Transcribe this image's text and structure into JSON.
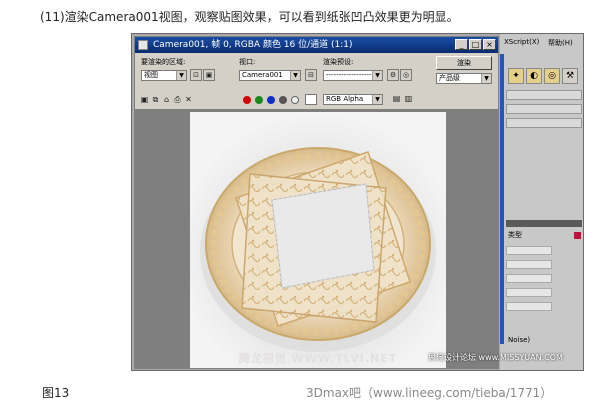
{
  "article": {
    "caption": "(11)渲染Camera001视图，观察贴图效果，可以看到纸张凹凸效果更为明显。",
    "figure_label": "图13",
    "bottom_watermark": "3Dmax吧（www.lineeg.com/tieba/1771）"
  },
  "render_window": {
    "title": "Camera001, 帧 0, RGBA 颜色 16 位/通道 (1:1)",
    "controls": {
      "min": "_",
      "restore": "□",
      "close": "×"
    },
    "area_label": "要渲染的区域:",
    "area_value": "视图",
    "viewport_label": "视口:",
    "viewport_value": "Camera001",
    "preset_label": "渲染预设:",
    "preset_value": "--------------------",
    "render_button": "渲染",
    "product_value": "产品级",
    "channel_value": "RGB Alpha",
    "swatch_colors": [
      "#d40000",
      "#1a8a1a",
      "#1030c0"
    ],
    "canvas_watermark": "腾龙视觉 WWW.TLVI.NET"
  },
  "right_panel": {
    "menu": [
      "XScript(X)",
      "帮助(H)"
    ],
    "rollout_label": "类型",
    "noise_label": "Noise)",
    "forum_watermark": "思缘设计论坛 www.MISSYUAN.COM"
  }
}
